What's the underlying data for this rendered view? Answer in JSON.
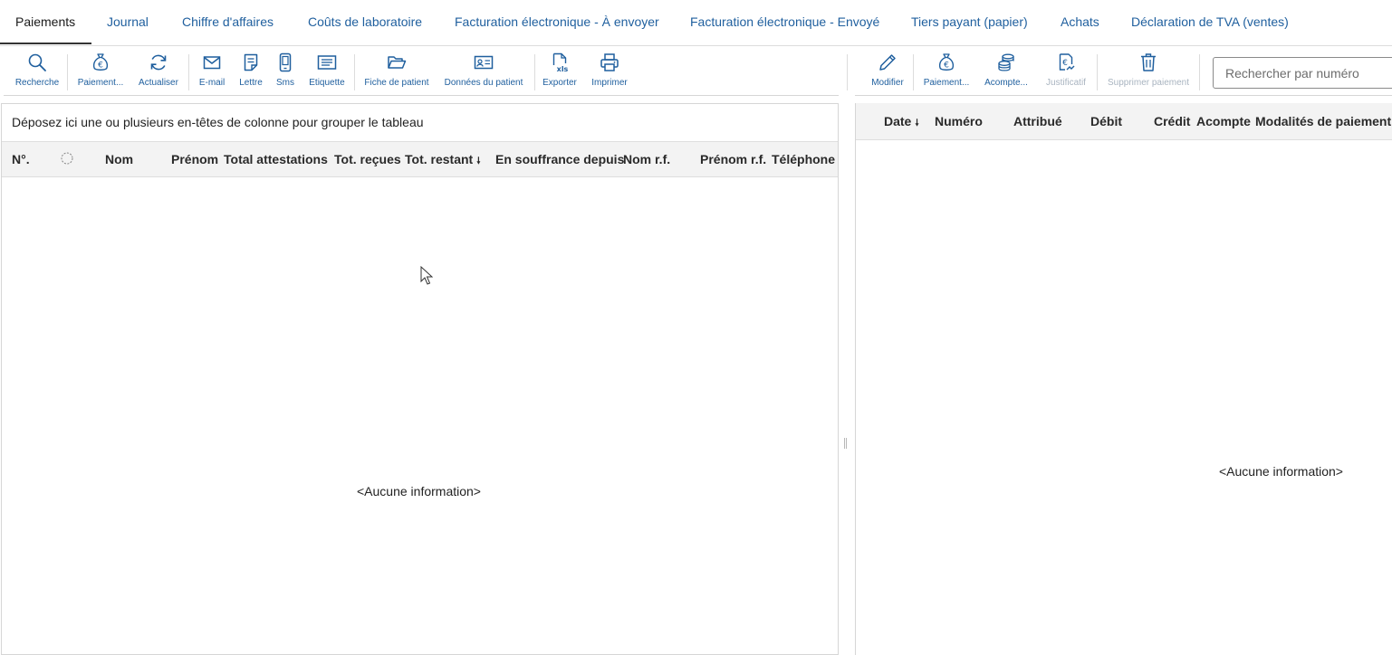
{
  "tabs": [
    {
      "label": "Paiements",
      "active": true
    },
    {
      "label": "Journal"
    },
    {
      "label": "Chiffre d'affaires"
    },
    {
      "label": "Coûts de laboratoire"
    },
    {
      "label": "Facturation électronique - À envoyer"
    },
    {
      "label": "Facturation électronique - Envoyé"
    },
    {
      "label": "Tiers payant (papier)"
    },
    {
      "label": "Achats"
    },
    {
      "label": "Déclaration de TVA (ventes)"
    }
  ],
  "left_toolbar": {
    "recherche": "Recherche",
    "paiement": "Paiement...",
    "actualiser": "Actualiser",
    "email": "E-mail",
    "lettre": "Lettre",
    "sms": "Sms",
    "etiquette": "Etiquette",
    "fiche_patient": "Fiche de patient",
    "donnees_patient": "Données du patient",
    "exporter": "Exporter",
    "imprimer": "Imprimer"
  },
  "right_toolbar": {
    "modifier": "Modifier",
    "paiement": "Paiement...",
    "acompte": "Acompte...",
    "justificatif": "Justificatif",
    "supprimer": "Supprimer paiement",
    "search_placeholder": "Rechercher par numéro"
  },
  "left_grid": {
    "group_hint": "Déposez ici une ou plusieurs en-têtes de colonne pour grouper le tableau",
    "columns": {
      "num": "N°.",
      "nom": "Nom",
      "prenom": "Prénom",
      "total_attestations": "Total attestations",
      "tot_recues": "Tot. reçues",
      "tot_restant": "Tot. restant",
      "en_souffrance": "En souffrance depuis",
      "nom_rf": "Nom r.f.",
      "prenom_rf": "Prénom r.f.",
      "telephone": "Téléphone r"
    },
    "sort_arrow": "🠗",
    "empty": "<Aucune information>"
  },
  "right_grid": {
    "columns": {
      "date": "Date",
      "numero": "Numéro",
      "attribue": "Attribué",
      "debit": "Débit",
      "credit": "Crédit",
      "acompte": "Acompte",
      "modalites": "Modalités de paiement"
    },
    "sort_arrow": "🠗",
    "empty": "<Aucune information>"
  },
  "colors": {
    "accent": "#1f5f9e",
    "header_bg": "#f3f3f3",
    "border": "#d6d6d6"
  }
}
